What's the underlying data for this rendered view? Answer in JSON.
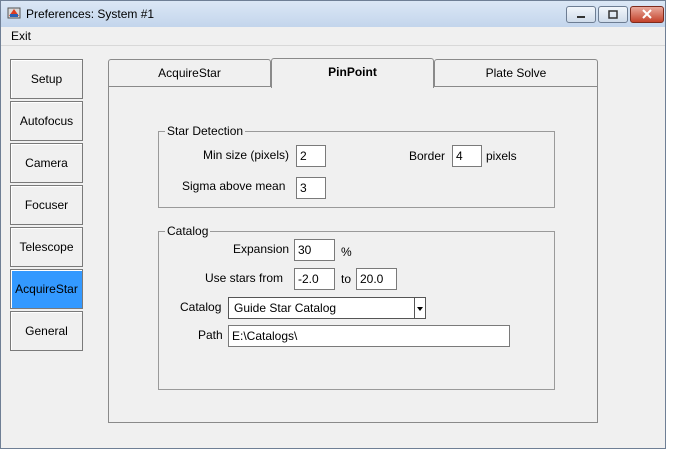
{
  "window": {
    "title": "Preferences: System #1"
  },
  "menu": {
    "exit": "Exit"
  },
  "sidebar": {
    "items": [
      {
        "label": "Setup"
      },
      {
        "label": "Autofocus"
      },
      {
        "label": "Camera"
      },
      {
        "label": "Focuser"
      },
      {
        "label": "Telescope"
      },
      {
        "label": "AcquireStar",
        "active": true
      },
      {
        "label": "General"
      }
    ]
  },
  "tabs": [
    {
      "label": "AcquireStar"
    },
    {
      "label": "PinPoint",
      "active": true
    },
    {
      "label": "Plate Solve"
    }
  ],
  "star_detection": {
    "legend": "Star Detection",
    "min_size_label": "Min size (pixels)",
    "min_size_value": "2",
    "border_label": "Border",
    "border_value": "4",
    "border_unit": "pixels",
    "sigma_label": "Sigma above mean",
    "sigma_value": "3"
  },
  "catalog_group": {
    "legend": "Catalog",
    "expansion_label": "Expansion",
    "expansion_value": "30",
    "expansion_unit": "%",
    "use_stars_label": "Use stars from",
    "from_value": "-2.0",
    "to_label": "to",
    "to_value": "20.0",
    "catalog_label": "Catalog",
    "catalog_value": "Guide Star Catalog",
    "path_label": "Path",
    "path_value": "E:\\Catalogs\\"
  },
  "colors": {
    "active_button": "#3399ff",
    "window_bg": "#f0f0f0"
  }
}
